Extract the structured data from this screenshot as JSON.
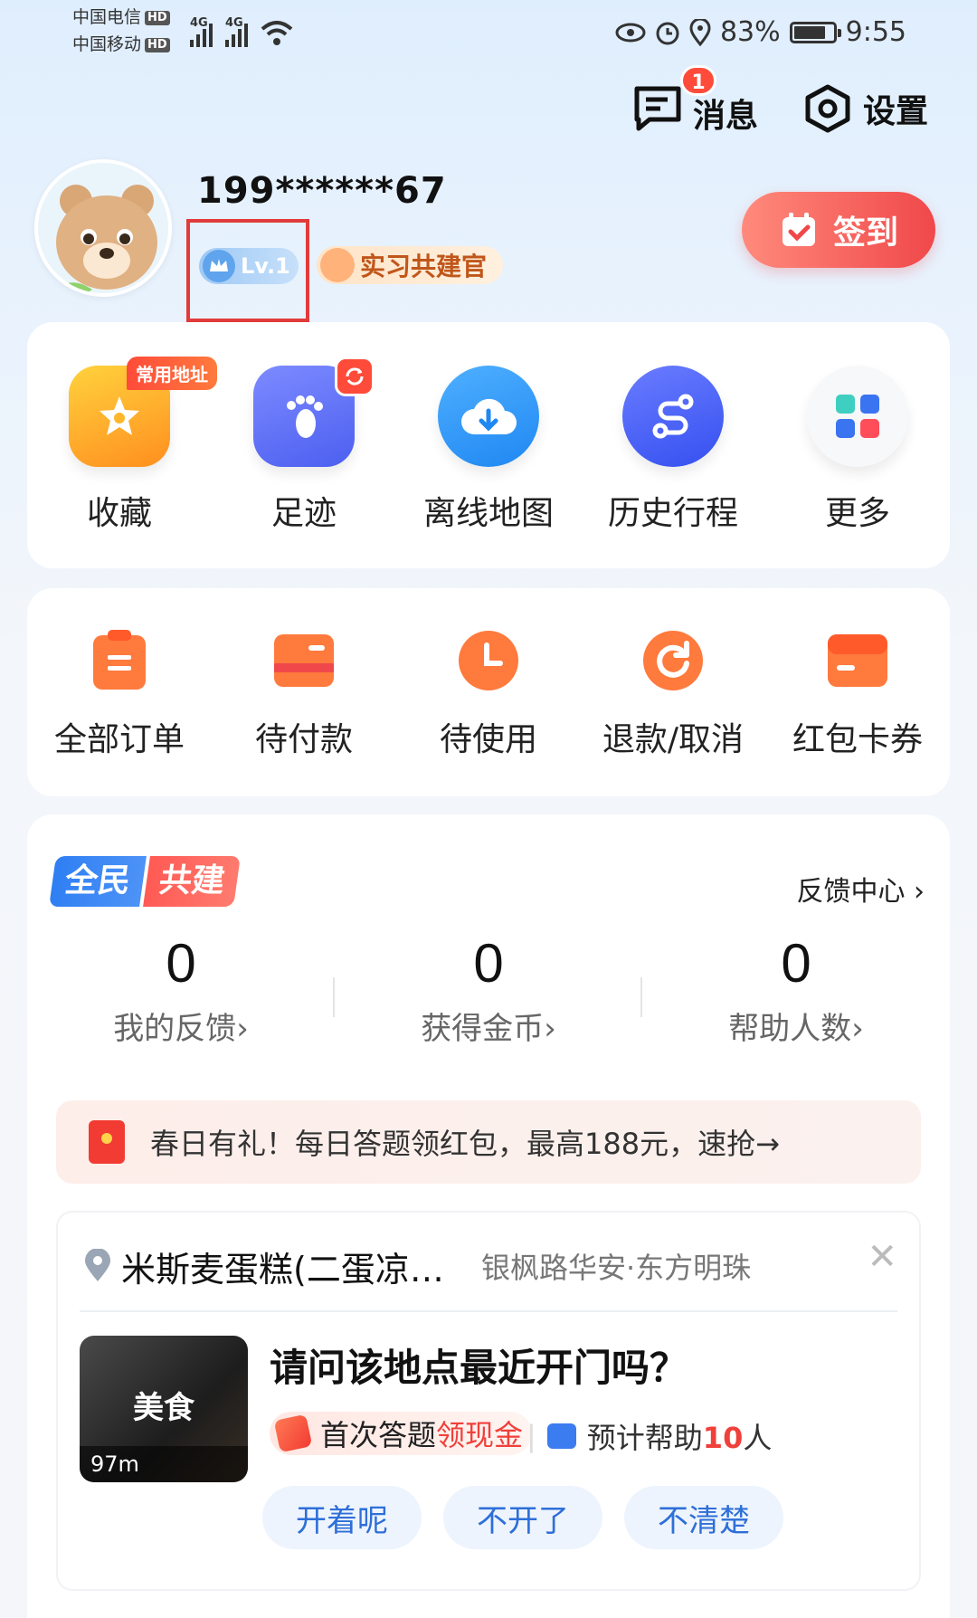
{
  "status_bar": {
    "carrier_1": "中国电信",
    "carrier_2": "中国移动",
    "hd": "HD",
    "net": "4G",
    "battery": "83%",
    "battery_level": 0.83,
    "time": "9:55"
  },
  "header": {
    "messages_label": "消息",
    "messages_badge": "1",
    "settings_label": "设置"
  },
  "profile": {
    "phone": "199******67",
    "level": "Lv.1",
    "title_badge": "实习共建官",
    "checkin_label": "签到"
  },
  "shortcuts": [
    {
      "label": "收藏",
      "icon": "star-icon",
      "tag": "常用地址"
    },
    {
      "label": "足迹",
      "icon": "footprint-icon"
    },
    {
      "label": "离线地图",
      "icon": "cloud-download-icon"
    },
    {
      "label": "历史行程",
      "icon": "route-icon"
    },
    {
      "label": "更多",
      "icon": "grid-icon"
    }
  ],
  "orders": [
    {
      "label": "全部订单",
      "icon": "order-list-icon"
    },
    {
      "label": "待付款",
      "icon": "wallet-card-icon"
    },
    {
      "label": "待使用",
      "icon": "clock-icon"
    },
    {
      "label": "退款/取消",
      "icon": "refund-icon"
    },
    {
      "label": "红包卡券",
      "icon": "coupon-icon"
    }
  ],
  "cobuild": {
    "logo_part_1": "全民",
    "logo_part_2": "共建",
    "feedback_center": "反馈中心",
    "stats": [
      {
        "value": "0",
        "label": "我的反馈"
      },
      {
        "value": "0",
        "label": "获得金币"
      },
      {
        "value": "0",
        "label": "帮助人数"
      }
    ],
    "banner": "春日有礼！每日答题领红包，最高188元，速抢→"
  },
  "place_question": {
    "place_name": "米斯麦蛋糕(二蛋凉…",
    "address": "银枫路华安·东方明珠",
    "thumb_label": "美食",
    "distance": "97m",
    "question": "请问该地点最近开门吗？",
    "reward_text": "首次答题",
    "reward_highlight": "领现金",
    "help_prefix": "预计帮助",
    "help_count": "10",
    "help_suffix": "人",
    "answers": [
      "开着呢",
      "不开了",
      "不清楚"
    ]
  },
  "colors": {
    "accent_red": "#f0484a",
    "accent_blue": "#2f7ff3",
    "order_orange": "#ff7a3d"
  }
}
